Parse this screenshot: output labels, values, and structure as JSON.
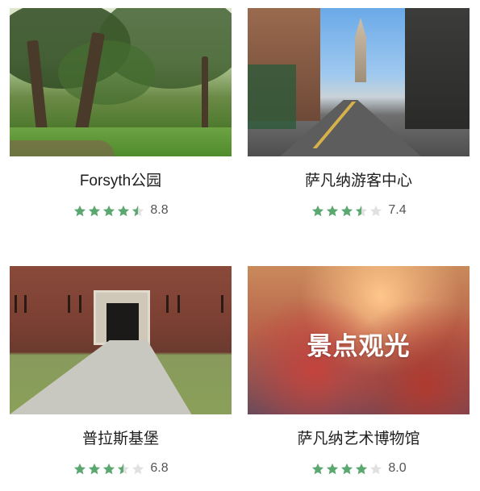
{
  "colors": {
    "star_filled": "#5aa870",
    "star_empty": "#e1e1e1",
    "title_text": "#1e1e1e",
    "score_text": "#555555"
  },
  "cards": [
    {
      "title": "Forsyth公园",
      "image": "park-photo",
      "stars": 4.5,
      "score": "8.8"
    },
    {
      "title": "萨凡纳游客中心",
      "image": "street-photo",
      "stars": 3.5,
      "score": "7.4"
    },
    {
      "title": "普拉斯基堡",
      "image": "fort-photo",
      "stars": 3.5,
      "score": "6.8"
    },
    {
      "title": "萨凡纳艺术博物馆",
      "image": "banner-photo",
      "banner_text": "景点观光",
      "stars": 4,
      "score": "8.0"
    }
  ]
}
